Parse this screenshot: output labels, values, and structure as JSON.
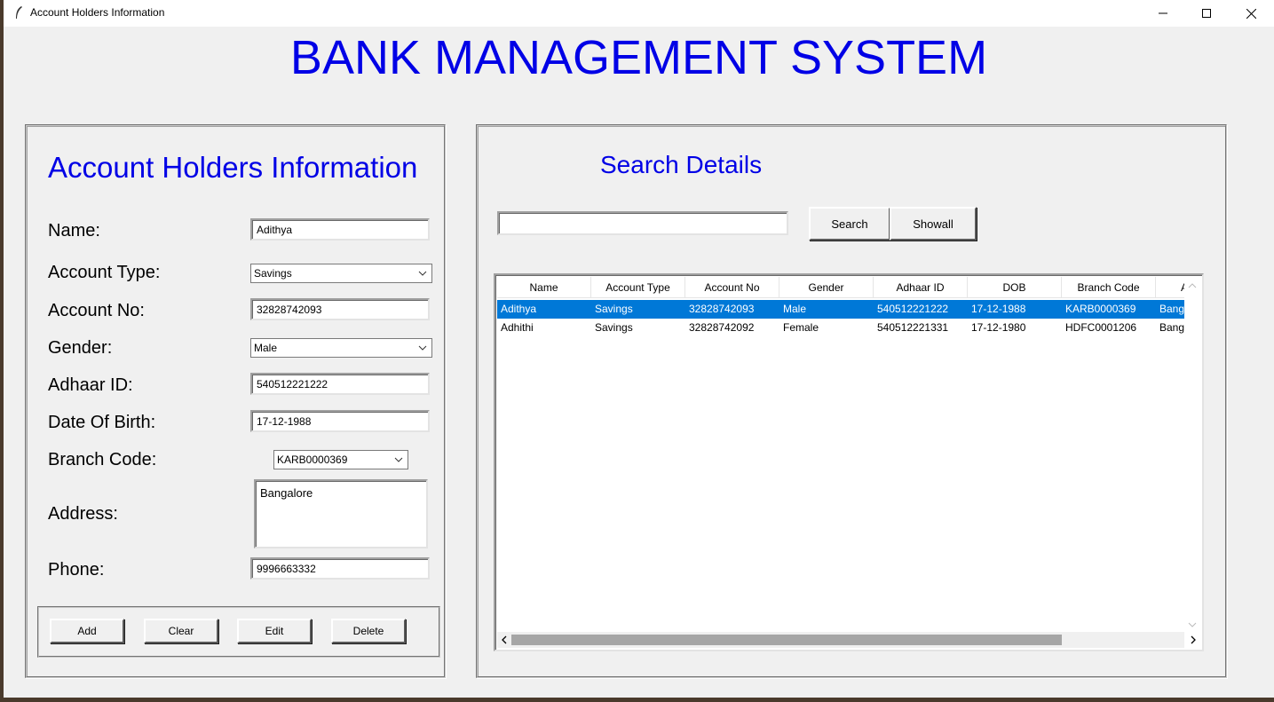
{
  "window": {
    "title": "Account Holders Information"
  },
  "app_title": "BANK MANAGEMENT SYSTEM",
  "form": {
    "section_title": "Account Holders Information",
    "labels": {
      "name": "Name:",
      "account_type": "Account Type:",
      "account_no": "Account No:",
      "gender": "Gender:",
      "adhaar_id": "Adhaar ID:",
      "dob": "Date Of Birth:",
      "branch_code": "Branch Code:",
      "address": "Address:",
      "phone": "Phone:"
    },
    "values": {
      "name": "Adithya",
      "account_type": "Savings",
      "account_no": "32828742093",
      "gender": "Male",
      "adhaar_id": "540512221222",
      "dob": "17-12-1988",
      "branch_code": "KARB0000369",
      "address": "Bangalore",
      "phone": "9996663332"
    },
    "buttons": {
      "add": "Add",
      "clear": "Clear",
      "edit": "Edit",
      "delete": "Delete"
    }
  },
  "search": {
    "section_title": "Search Details",
    "query": "",
    "search_button": "Search",
    "showall_button": "Showall"
  },
  "table": {
    "columns": [
      "Name",
      "Account Type",
      "Account No",
      "Gender",
      "Adhaar ID",
      "DOB",
      "Branch Code",
      "A"
    ],
    "rows": [
      [
        "Adithya",
        "Savings",
        "32828742093",
        "Male",
        "540512221222",
        "17-12-1988",
        "KARB0000369",
        "Banga"
      ],
      [
        "Adhithi",
        "Savings",
        "32828742092",
        "Female",
        "540512221331",
        "17-12-1980",
        "HDFC0001206",
        "Banga"
      ]
    ],
    "selected_row": 0
  },
  "colors": {
    "title_blue": "#0000e6",
    "selection": "#0078d7",
    "window_bg": "#f0f0f0"
  }
}
